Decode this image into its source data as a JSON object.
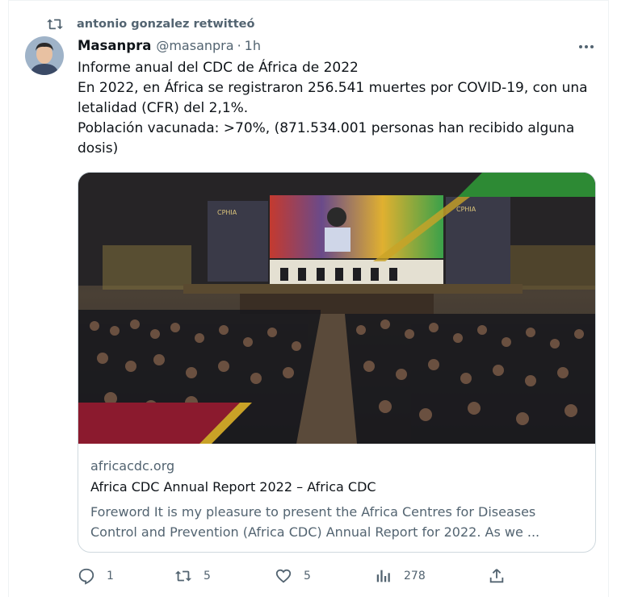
{
  "retweet": {
    "icon": "retweet-icon",
    "text": "antonio gonzalez retwitteó"
  },
  "author": {
    "name": "Masanpra",
    "handle": "@masanpra",
    "separator": "·",
    "time": "1h"
  },
  "tweet": {
    "lines": [
      "Informe anual del CDC de África de 2022",
      "En 2022, en África se registraron 256.541 muertes por COVID-19, con una letalidad (CFR) del 2,1%.",
      "Población vacunada: >70%, (871.534.001 personas han recibido alguna dosis)"
    ]
  },
  "card": {
    "domain": "africacdc.org",
    "title": "Africa CDC Annual Report 2022 – Africa CDC",
    "description": "Foreword It is my pleasure to present the Africa Centres for Diseases Control and Prevention (Africa CDC) Annual Report for 2022. As we ...",
    "image": {
      "screen_brand": "CPHIA",
      "screen_brand_right": "CPHIA"
    }
  },
  "actions": {
    "reply_count": "1",
    "retweet_count": "5",
    "like_count": "5",
    "views_count": "278"
  },
  "colors": {
    "text": "#0f1419",
    "secondary": "#536471",
    "border": "#cfd9de",
    "accent_green": "#2d8a34",
    "accent_maroon": "#8b1a2e",
    "accent_gold": "#c9a227"
  }
}
